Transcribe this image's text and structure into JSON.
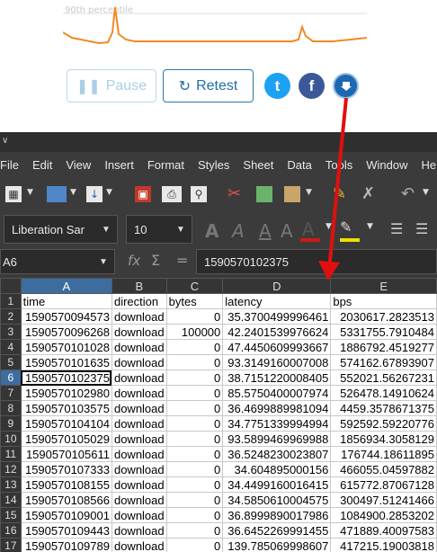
{
  "web": {
    "chart_label": "90th percentile",
    "pause_label": "Pause",
    "retest_label": "Retest",
    "pause_icon": "pause-icon",
    "retest_icon": "refresh-icon",
    "social": [
      "twitter-icon",
      "facebook-icon",
      "download-icon"
    ],
    "accent": "#1f6ea5",
    "line_color": "#f08a24"
  },
  "menu": [
    "File",
    "Edit",
    "View",
    "Insert",
    "Format",
    "Styles",
    "Sheet",
    "Data",
    "Tools",
    "Window",
    "Help"
  ],
  "toolbar": {
    "font_name": "Liberation Sar",
    "font_size": "10"
  },
  "formula": {
    "cell_ref": "A6",
    "fx": "fx",
    "sigma": "Σ",
    "eq": "=",
    "value": "1590570102375"
  },
  "sheet": {
    "columns": [
      "A",
      "B",
      "C",
      "D",
      "E"
    ],
    "header": [
      "time",
      "direction",
      "bytes",
      "latency",
      "bps"
    ],
    "rows": [
      [
        "1590570094573",
        "download",
        "0",
        "35.3700499996461",
        "2030617.2823513"
      ],
      [
        "1590570096268",
        "download",
        "100000",
        "42.2401539976624",
        "5331755.7910484"
      ],
      [
        "1590570101028",
        "download",
        "0",
        "47.4450609993667",
        "1886792.4519277"
      ],
      [
        "1590570101635",
        "download",
        "0",
        "93.3149160007008",
        "574162.67893907"
      ],
      [
        "1590570102375",
        "download",
        "0",
        "38.7151220008405",
        "552021.56267231"
      ],
      [
        "1590570102980",
        "download",
        "0",
        "85.5750400007974",
        "526478.14910624"
      ],
      [
        "1590570103575",
        "download",
        "0",
        "36.4699889981094",
        "4459.3578671375"
      ],
      [
        "1590570104104",
        "download",
        "0",
        "34.7751339994994",
        "592592.59220776"
      ],
      [
        "1590570105029",
        "download",
        "0",
        "93.5899469969988",
        "1856934.3058129"
      ],
      [
        "1590570105611",
        "download",
        "0",
        "36.5248230023807",
        "176744.18611895"
      ],
      [
        "1590570107333",
        "download",
        "0",
        "34.604895000156",
        "466055.04597882"
      ],
      [
        "1590570108155",
        "download",
        "0",
        "34.4499160016415",
        "615772.87067128"
      ],
      [
        "1590570108566",
        "download",
        "0",
        "34.5850610004575",
        "300497.51241466"
      ],
      [
        "1590570109001",
        "download",
        "0",
        "36.8999890017986",
        "1084900.2853202"
      ],
      [
        "1590570109443",
        "download",
        "0",
        "36.6452269991455",
        "471889.40097583"
      ],
      [
        "1590570109789",
        "download",
        "0",
        "139.785069998607",
        "417215.19003818"
      ]
    ],
    "selected_row": 6,
    "selected_col": "A"
  }
}
